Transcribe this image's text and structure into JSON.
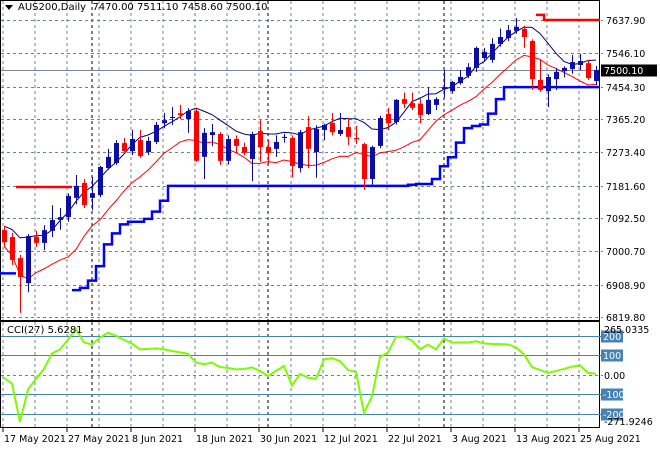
{
  "header": {
    "symbol": "AUS200,Daily",
    "open": "7470.00",
    "high": "7511.10",
    "low": "7458.60",
    "close": "7500.10"
  },
  "cci_label": {
    "name": "CCI(27)",
    "value": "5.6281"
  },
  "colors": {
    "bull": "#0c0ca6",
    "bear": "#ff0000",
    "ma_fast": "#000080",
    "ma_slow": "#ff0000",
    "stop_line": "#0000ff",
    "cci_line": "#7cfc00",
    "level_line": "#4682b4",
    "grid": "#708090"
  },
  "chart_data": [
    {
      "type": "candlestick",
      "title": "AUS200,Daily",
      "ylim": [
        6819.8,
        7637.9
      ],
      "price_ticks": [
        "7637.90",
        "7546.10",
        "7454.30",
        "7365.20",
        "7273.40",
        "7181.60",
        "7092.50",
        "7000.70",
        "6908.90",
        "6819.80"
      ],
      "current_price": "7500.10",
      "date_labels": [
        {
          "label": "17 May 2021",
          "index": 0
        },
        {
          "label": "27 May 2021",
          "index": 8
        },
        {
          "label": "8 Jun 2021",
          "index": 16
        },
        {
          "label": "18 Jun 2021",
          "index": 24
        },
        {
          "label": "30 Jun 2021",
          "index": 32
        },
        {
          "label": "12 Jul 2021",
          "index": 40
        },
        {
          "label": "22 Jul 2021",
          "index": 48
        },
        {
          "label": "3 Aug 2021",
          "index": 56
        },
        {
          "label": "13 Aug 2021",
          "index": 64
        },
        {
          "label": "25 Aug 2021",
          "index": 72
        }
      ],
      "period_separators": [
        11,
        33,
        55
      ],
      "ohlc": [
        [
          7059,
          7070,
          7015,
          7026
        ],
        [
          7040,
          7052,
          6963,
          6977
        ],
        [
          6982,
          6991,
          6831,
          6930
        ],
        [
          6913,
          7048,
          6888,
          7043
        ],
        [
          7040,
          7057,
          7013,
          7024
        ],
        [
          7024,
          7073,
          7004,
          7059
        ],
        [
          7057,
          7128,
          7040,
          7087
        ],
        [
          7087,
          7120,
          7060,
          7095
        ],
        [
          7095,
          7160,
          7082,
          7153
        ],
        [
          7148,
          7211,
          7130,
          7181
        ],
        [
          7189,
          7200,
          7120,
          7128
        ],
        [
          7148,
          7205,
          7114,
          7161
        ],
        [
          7156,
          7236,
          7150,
          7233
        ],
        [
          7230,
          7283,
          7225,
          7261
        ],
        [
          7244,
          7307,
          7239,
          7299
        ],
        [
          7299,
          7313,
          7274,
          7277
        ],
        [
          7277,
          7335,
          7266,
          7310
        ],
        [
          7307,
          7335,
          7258,
          7263
        ],
        [
          7274,
          7316,
          7266,
          7305
        ],
        [
          7302,
          7357,
          7296,
          7349
        ],
        [
          7354,
          7382,
          7340,
          7362
        ],
        [
          7368,
          7398,
          7349,
          7371
        ],
        [
          7381,
          7404,
          7365,
          7376
        ],
        [
          7365,
          7395,
          7327,
          7387
        ],
        [
          7387,
          7396,
          7247,
          7250
        ],
        [
          7261,
          7340,
          7200,
          7327
        ],
        [
          7321,
          7351,
          7290,
          7329
        ],
        [
          7324,
          7329,
          7239,
          7250
        ],
        [
          7250,
          7320,
          7240,
          7310
        ],
        [
          7310,
          7320,
          7270,
          7291
        ],
        [
          7288,
          7300,
          7265,
          7272
        ],
        [
          7255,
          7330,
          7194,
          7324
        ],
        [
          7332,
          7362,
          7247,
          7288
        ],
        [
          7288,
          7307,
          7241,
          7272
        ],
        [
          7283,
          7320,
          7261,
          7302
        ],
        [
          7313,
          7325,
          7300,
          7316
        ],
        [
          7313,
          7320,
          7205,
          7236
        ],
        [
          7230,
          7335,
          7218,
          7329
        ],
        [
          7343,
          7373,
          7230,
          7283
        ],
        [
          7274,
          7348,
          7203,
          7338
        ],
        [
          7335,
          7352,
          7307,
          7349
        ],
        [
          7354,
          7382,
          7320,
          7329
        ],
        [
          7324,
          7382,
          7318,
          7335
        ],
        [
          7343,
          7368,
          7294,
          7316
        ],
        [
          7313,
          7346,
          7296,
          7310
        ],
        [
          7296,
          7300,
          7170,
          7200
        ],
        [
          7200,
          7292,
          7184,
          7288
        ],
        [
          7291,
          7374,
          7285,
          7368
        ],
        [
          7379,
          7396,
          7335,
          7354
        ],
        [
          7357,
          7420,
          7350,
          7418
        ],
        [
          7420,
          7438,
          7395,
          7407
        ],
        [
          7409,
          7438,
          7390,
          7396
        ],
        [
          7407,
          7420,
          7354,
          7376
        ],
        [
          7379,
          7453,
          7376,
          7418
        ],
        [
          7404,
          7425,
          7390,
          7420
        ],
        [
          7448,
          7500,
          7425,
          7453
        ],
        [
          7442,
          7470,
          7435,
          7467
        ],
        [
          7464,
          7500,
          7460,
          7481
        ],
        [
          7484,
          7519,
          7478,
          7508
        ],
        [
          7506,
          7565,
          7495,
          7561
        ],
        [
          7533,
          7561,
          7525,
          7550
        ],
        [
          7528,
          7588,
          7520,
          7572
        ],
        [
          7572,
          7614,
          7565,
          7591
        ],
        [
          7588,
          7624,
          7580,
          7610
        ],
        [
          7608,
          7643,
          7600,
          7619
        ],
        [
          7613,
          7622,
          7561,
          7591
        ],
        [
          7580,
          7585,
          7445,
          7475
        ],
        [
          7473,
          7530,
          7440,
          7445
        ],
        [
          7442,
          7488,
          7398,
          7481
        ],
        [
          7475,
          7506,
          7445,
          7495
        ],
        [
          7497,
          7510,
          7480,
          7506
        ],
        [
          7503,
          7542,
          7490,
          7522
        ],
        [
          7514,
          7545,
          7500,
          7525
        ],
        [
          7519,
          7528,
          7473,
          7478
        ],
        [
          7470,
          7511.1,
          7458.6,
          7500.1
        ]
      ],
      "stop_line": [
        6940,
        6940,
        null,
        null,
        null,
        null,
        null,
        null,
        null,
        6894,
        6900,
        6920,
        6960,
        7020,
        7050,
        7075,
        7082,
        7082,
        7090,
        7110,
        7140,
        7181,
        7181,
        7181,
        7181,
        7181,
        7181,
        7181,
        7181,
        7181,
        7181,
        7181,
        7181,
        7181,
        7181,
        7181,
        7181,
        7181,
        7181,
        7181,
        7181,
        7181,
        7181,
        7181,
        7181,
        7181,
        7181,
        7181,
        7181,
        7181,
        7181,
        7184,
        7186,
        7186,
        7200,
        7235,
        7260,
        7300,
        7340,
        7346,
        7350,
        7380,
        7420,
        7453,
        7453,
        7453,
        7453,
        7453,
        7453,
        7453,
        7453,
        7453,
        7453,
        7453,
        7453
      ],
      "resistance_line": [
        null,
        null,
        7178,
        7178,
        7178,
        7178,
        7178,
        7178,
        7178,
        null,
        null,
        null,
        null,
        null,
        null,
        null,
        null,
        null,
        null,
        null,
        null,
        null,
        null,
        null,
        null,
        null,
        null,
        null,
        null,
        null,
        null,
        null,
        null,
        null,
        null,
        null,
        null,
        null,
        null,
        null,
        null,
        null,
        null,
        null,
        null,
        null,
        null,
        null,
        null,
        null,
        null,
        null,
        null,
        null,
        null,
        null,
        null,
        null,
        null,
        null,
        null,
        null,
        null,
        null,
        null,
        null,
        null,
        7652,
        7637.9,
        7637.9,
        7637.9,
        7637.9,
        7637.9,
        7637.9,
        7637.9
      ]
    },
    {
      "type": "line",
      "title": "CCI(27)",
      "ylim": [
        -271.9246,
        265.0335
      ],
      "tick_labels": {
        "top": "265.0335",
        "bottom": "-271.9246",
        "zero": "0.00"
      },
      "levels": [
        {
          "value": 200,
          "label": "200"
        },
        {
          "value": 100,
          "label": "100"
        },
        {
          "value": -100,
          "label": "-100"
        },
        {
          "value": -200,
          "label": "-200"
        }
      ],
      "values": [
        -15,
        -45,
        -240,
        -75,
        -20,
        30,
        110,
        130,
        180,
        235,
        165,
        155,
        190,
        215,
        200,
        178,
        160,
        130,
        133,
        135,
        130,
        122,
        115,
        108,
        62,
        55,
        62,
        40,
        35,
        28,
        30,
        38,
        20,
        -5,
        20,
        45,
        -55,
        5,
        -15,
        -20,
        78,
        85,
        70,
        25,
        15,
        -195,
        -110,
        90,
        115,
        195,
        195,
        175,
        130,
        155,
        130,
        185,
        165,
        165,
        165,
        172,
        160,
        158,
        157,
        156,
        140,
        105,
        40,
        25,
        10,
        20,
        30,
        42,
        48,
        10,
        5.6281
      ]
    }
  ]
}
